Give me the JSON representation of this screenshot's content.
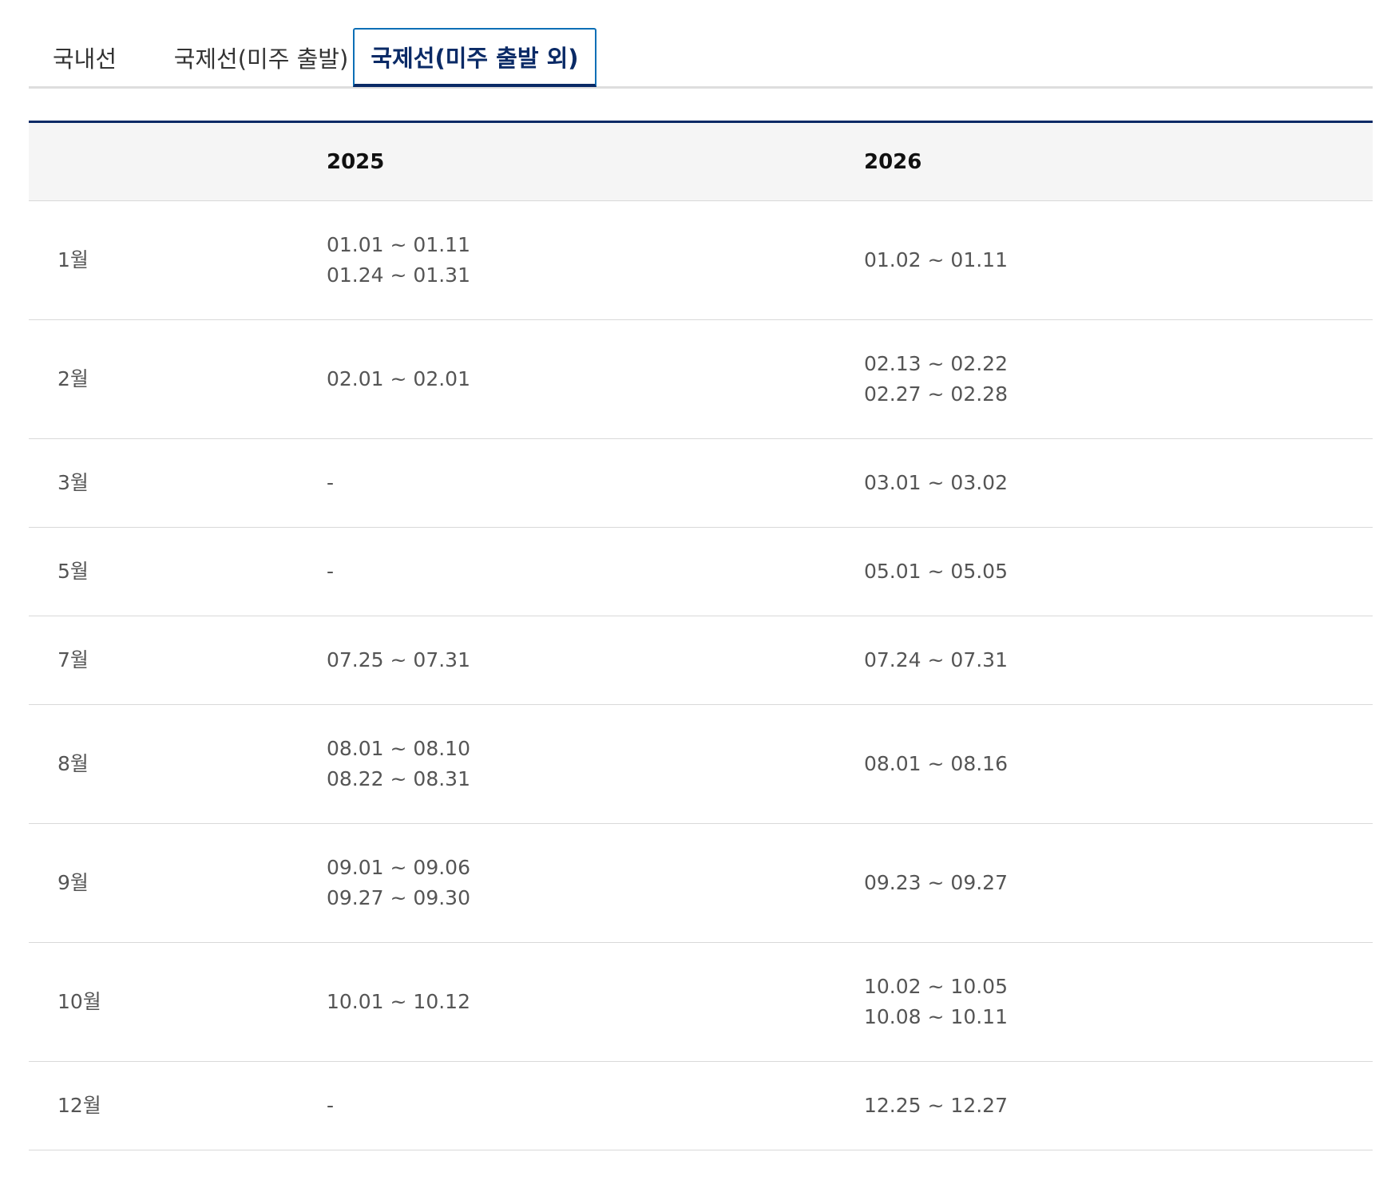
{
  "tabs": [
    {
      "label": "국내선",
      "active": false
    },
    {
      "label": "국제선(미주 출발)",
      "active": false
    },
    {
      "label": "국제선(미주 출발 외)",
      "active": true
    }
  ],
  "table": {
    "headers": [
      "",
      "2025",
      "2026"
    ],
    "rows": [
      {
        "month": "1월",
        "y2025": [
          "01.01 ~ 01.11",
          "01.24 ~ 01.31"
        ],
        "y2026": [
          "01.02 ~ 01.11"
        ]
      },
      {
        "month": "2월",
        "y2025": [
          "02.01 ~ 02.01"
        ],
        "y2026": [
          "02.13 ~ 02.22",
          "02.27 ~ 02.28"
        ]
      },
      {
        "month": "3월",
        "y2025": [
          "-"
        ],
        "y2026": [
          "03.01 ~ 03.02"
        ]
      },
      {
        "month": "5월",
        "y2025": [
          "-"
        ],
        "y2026": [
          "05.01 ~ 05.05"
        ]
      },
      {
        "month": "7월",
        "y2025": [
          "07.25 ~ 07.31"
        ],
        "y2026": [
          "07.24 ~ 07.31"
        ]
      },
      {
        "month": "8월",
        "y2025": [
          "08.01 ~ 08.10",
          "08.22 ~ 08.31"
        ],
        "y2026": [
          "08.01 ~ 08.16"
        ]
      },
      {
        "month": "9월",
        "y2025": [
          "09.01 ~ 09.06",
          "09.27 ~ 09.30"
        ],
        "y2026": [
          "09.23 ~ 09.27"
        ]
      },
      {
        "month": "10월",
        "y2025": [
          "10.01 ~ 10.12"
        ],
        "y2026": [
          "10.02 ~ 10.05",
          "10.08 ~ 10.11"
        ]
      },
      {
        "month": "12월",
        "y2025": [
          "-"
        ],
        "y2026": [
          "12.25 ~ 12.27"
        ]
      }
    ]
  },
  "colors": {
    "active_tab_border": "#0c6fb6",
    "active_tab_text": "#0a2a66",
    "table_top_border": "#0a2a66",
    "header_bg": "#f5f5f5"
  }
}
